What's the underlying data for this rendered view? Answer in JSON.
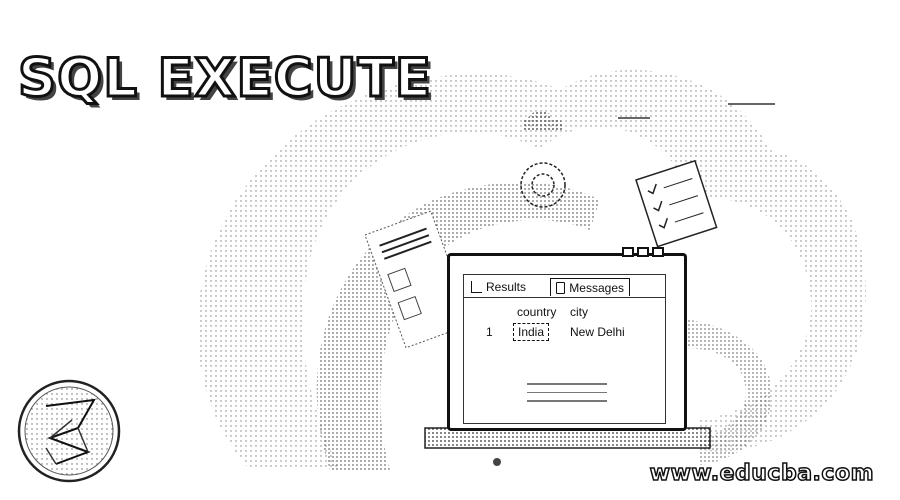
{
  "banner": {
    "title": "SQL EXECUTE",
    "website": "www.educba.com"
  },
  "results_window": {
    "tabs": [
      "Results",
      "Messages"
    ],
    "columns": [
      "country",
      "city"
    ],
    "rows": [
      {
        "num": "1",
        "country": "India",
        "city": "New Delhi"
      }
    ]
  },
  "icons": {
    "logo": "sql-server-logo-icon",
    "results_tab": "grid-icon",
    "messages_tab": "document-icon",
    "gear": "gear-icon",
    "checklist": "checklist-icon"
  },
  "colors": {
    "ink": "#111111",
    "background": "#ffffff"
  }
}
